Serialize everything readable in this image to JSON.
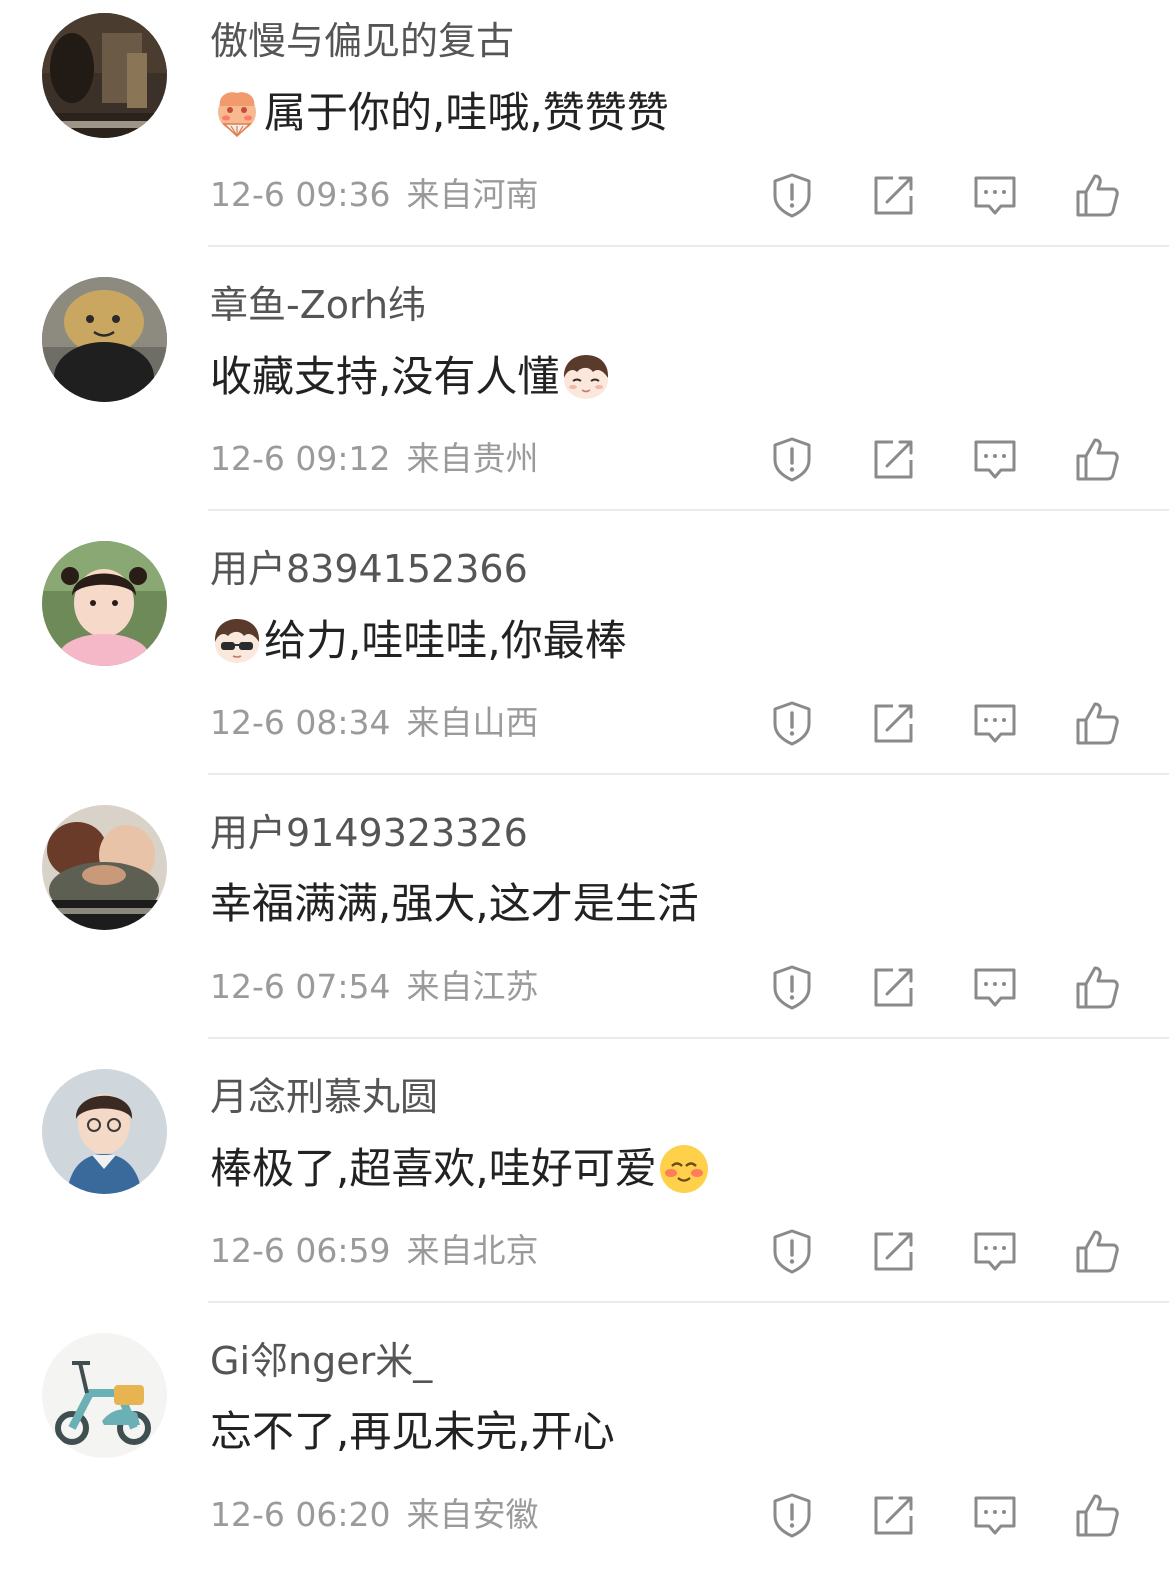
{
  "comments": [
    {
      "username": "傲慢与偏见的复古",
      "content_text": "属于你的,哇哦,赞赞赞",
      "emoji": "shy-fan-emoji",
      "emoji_position": "before",
      "time": "12-6 09:36",
      "location": "来自河南",
      "avatar": "dark-photo-avatar"
    },
    {
      "username": "章鱼-Zorh纬",
      "content_text": "收藏支持,没有人懂",
      "emoji": "boy-face-emoji",
      "emoji_position": "after",
      "time": "12-6 09:12",
      "location": "来自贵州",
      "avatar": "plush-octopus-avatar"
    },
    {
      "username": "用户8394152366",
      "content_text": "给力,哇哇哇,你最棒",
      "emoji": "cool-boy-emoji",
      "emoji_position": "before",
      "time": "12-6 08:34",
      "location": "来自山西",
      "avatar": "little-girl-avatar"
    },
    {
      "username": "用户9149323326",
      "content_text": "幸福满满,强大,这才是生活",
      "emoji": "",
      "emoji_position": "none",
      "time": "12-6 07:54",
      "location": "来自江苏",
      "avatar": "hug-photo-avatar"
    },
    {
      "username": "月念刑慕丸圆",
      "content_text": "棒极了,超喜欢,哇好可爱",
      "emoji": "blush-smile-emoji",
      "emoji_position": "after",
      "time": "12-6 06:59",
      "location": "来自北京",
      "avatar": "young-man-avatar"
    },
    {
      "username": "Gi邻nger米_",
      "content_text": "忘不了,再见未完,开心",
      "emoji": "",
      "emoji_position": "none",
      "time": "12-6 06:20",
      "location": "来自安徽",
      "avatar": "scooter-avatar"
    }
  ],
  "action_icons": [
    "report-icon",
    "repost-icon",
    "reply-icon",
    "like-icon"
  ],
  "colors": {
    "username": "#555555",
    "content": "#222222",
    "meta": "#9a9a9a",
    "icon": "#8a8a8a",
    "divider": "#ebebeb"
  }
}
